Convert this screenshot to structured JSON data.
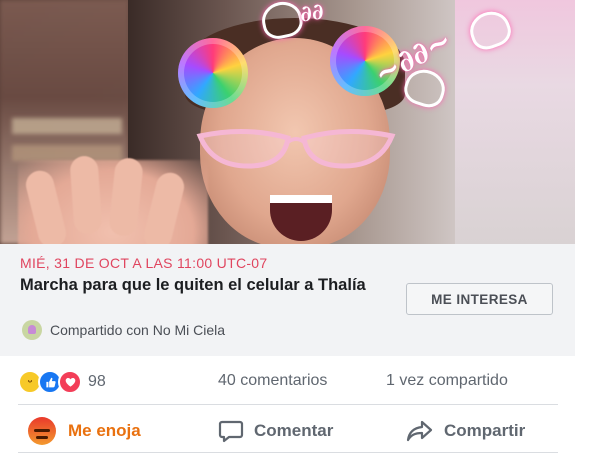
{
  "event": {
    "date": "MIÉ, 31 DE OCT A LAS 11:00 UTC-07",
    "title": "Marcha para que le quiten el celular a Thalía",
    "interest_button": "ME INTERESA",
    "shared_with": "Compartido con No Mi Ciela"
  },
  "reactions": {
    "types": [
      "haha-icon",
      "like-icon",
      "love-icon"
    ],
    "count": "98",
    "comments": "40 comentarios",
    "shares": "1 vez compartido"
  },
  "actions": {
    "react": "Me enoja",
    "comment": "Comentar",
    "share": "Compartir"
  },
  "colors": {
    "date_red": "#e0455f",
    "angry_orange": "#e9710f",
    "like_blue": "#1877f2",
    "love_red": "#f33e58"
  }
}
